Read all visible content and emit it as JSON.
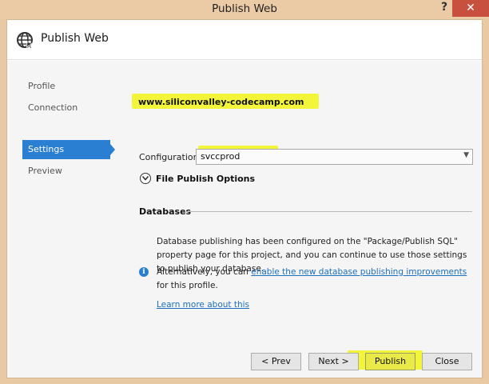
{
  "window": {
    "title": "Publish Web",
    "help_label": "?",
    "close_label": "✕"
  },
  "header": {
    "icon": "globe-icon",
    "title": "Publish Web"
  },
  "nav": {
    "items": [
      {
        "label": "Profile",
        "active": false
      },
      {
        "label": "Connection",
        "active": false
      },
      {
        "label": "Settings",
        "active": true
      },
      {
        "label": "Preview",
        "active": false
      }
    ]
  },
  "settings": {
    "site_url": "www.siliconvalley-codecamp.com",
    "configuration_label": "Configuration:",
    "configuration_value": "svccprod",
    "file_publish_options": "File Publish Options",
    "databases_title": "Databases",
    "databases_text": "Database publishing has been configured on the \"Package/Publish SQL\" property page for this project, and you can continue to use those settings to publish your database.",
    "info_prefix": "Alternatively, you can ",
    "info_link": "enable the new database publishing improvements",
    "info_suffix": " for this profile.",
    "learn_more": "Learn more about this"
  },
  "buttons": {
    "prev": "< Prev",
    "next": "Next >",
    "publish": "Publish",
    "close": "Close"
  },
  "colors": {
    "accent": "#2a7fd2",
    "highlight": "#f3f53a",
    "link": "#1e6fc0",
    "titlebar": "#ebcba6",
    "close_button": "#c7503f"
  }
}
